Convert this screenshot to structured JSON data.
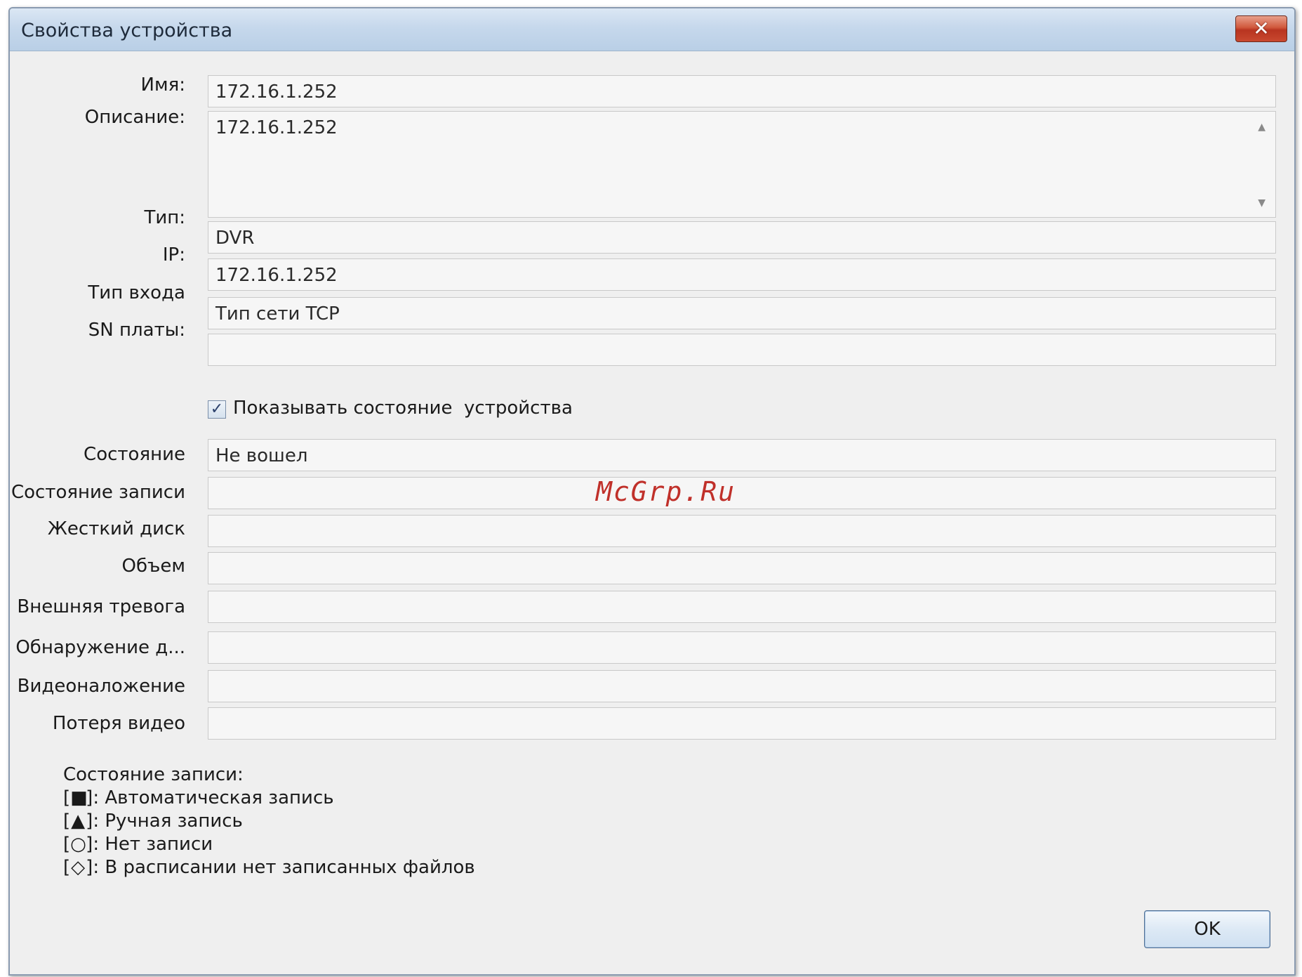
{
  "window": {
    "title": "Свойства устройства",
    "close_icon": "✕"
  },
  "fields": {
    "name_label": "Имя:",
    "name_value": "172.16.1.252",
    "description_label": "Описание:",
    "description_value": "172.16.1.252",
    "type_label": "Тип:",
    "type_value": "DVR",
    "ip_label": "IP:",
    "ip_value": "172.16.1.252",
    "login_type_label": "Тип входа",
    "login_type_value": "Тип сети TCP",
    "sn_label": "SN платы:",
    "sn_value": ""
  },
  "checkbox": {
    "label": "Показывать состояние  устройства",
    "checked": true,
    "check_glyph": "✓"
  },
  "status": {
    "state_label": "Состояние",
    "state_value": "Не вошел",
    "record_state_label": "Состояние записи",
    "record_state_value": "",
    "hdd_label": "Жесткий диск",
    "hdd_value": "",
    "volume_label": "Объем",
    "volume_value": "",
    "external_alarm_label": "Внешняя тревога",
    "external_alarm_value": "",
    "detection_label": "Обнаружение д...",
    "detection_value": "",
    "overlay_label": "Видеоналожение",
    "overlay_value": "",
    "video_loss_label": "Потеря видео",
    "video_loss_value": ""
  },
  "watermark": "McGrp.Ru",
  "legend": {
    "title": "Состояние записи:",
    "items": [
      {
        "open": "[",
        "symbol": "■",
        "close": "]",
        "text": ": Автоматическая запись"
      },
      {
        "open": "[",
        "symbol": "▲",
        "close": "]",
        "text": ": Ручная запись"
      },
      {
        "open": "[",
        "symbol": "○",
        "close": "]",
        "text": ": Нет записи"
      },
      {
        "open": "[",
        "symbol": "◇",
        "close": "]",
        "text": ": В расписании нет записанных файлов"
      }
    ]
  },
  "buttons": {
    "ok_label": "OK"
  },
  "icons": {
    "scroll_up": "▲",
    "scroll_down": "▼"
  },
  "colors": {
    "title_bar": "#c6d8ec",
    "close_button": "#c9482f",
    "watermark": "#c0302a"
  }
}
